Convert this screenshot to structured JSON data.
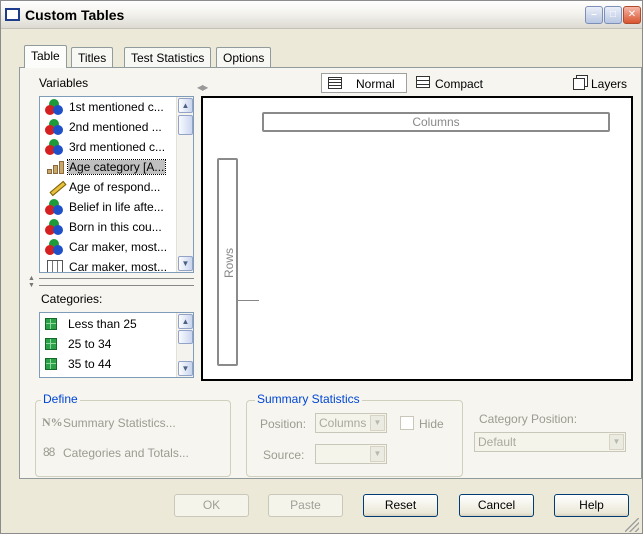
{
  "window": {
    "title": "Custom Tables"
  },
  "tabs": [
    {
      "label": "Table",
      "active": true
    },
    {
      "label": "Titles"
    },
    {
      "label": "Test Statistics"
    },
    {
      "label": "Options"
    }
  ],
  "variables": {
    "label": "Variables",
    "items": [
      {
        "label": "1st mentioned c...",
        "icon": "nominal-icon"
      },
      {
        "label": "2nd mentioned ...",
        "icon": "nominal-icon"
      },
      {
        "label": "3rd mentioned c...",
        "icon": "nominal-icon"
      },
      {
        "label": "Age category [A...",
        "icon": "ordinal-icon",
        "selected": true
      },
      {
        "label": "Age of respond...",
        "icon": "scale-icon"
      },
      {
        "label": "Belief in life afte...",
        "icon": "nominal-icon"
      },
      {
        "label": "Born in this cou...",
        "icon": "nominal-icon"
      },
      {
        "label": "Car maker, most...",
        "icon": "nominal-icon"
      },
      {
        "label": "Car maker, most...",
        "icon": "multiple-response-icon"
      }
    ]
  },
  "categories": {
    "label": "Categories:",
    "items": [
      "Less than 25",
      "25 to 34",
      "35 to 44"
    ]
  },
  "view": {
    "normal": "Normal",
    "compact": "Compact",
    "layers": "Layers"
  },
  "canvas": {
    "columns": "Columns",
    "rows": "Rows"
  },
  "define": {
    "legend": "Define",
    "summary_icon": "N%",
    "summary_label": "Summary Statistics...",
    "categories_label": "Categories and Totals..."
  },
  "summary_statistics": {
    "legend": "Summary Statistics",
    "position_label": "Position:",
    "position_value": "Columns",
    "hide_label": "Hide",
    "source_label": "Source:",
    "source_value": ""
  },
  "category_position": {
    "label": "Category Position:",
    "value": "Default"
  },
  "buttons": {
    "ok": "OK",
    "paste": "Paste",
    "reset": "Reset",
    "cancel": "Cancel",
    "help": "Help"
  },
  "colors": {
    "accent_legend": "#0046d5",
    "selection": "#c0c0c0"
  }
}
